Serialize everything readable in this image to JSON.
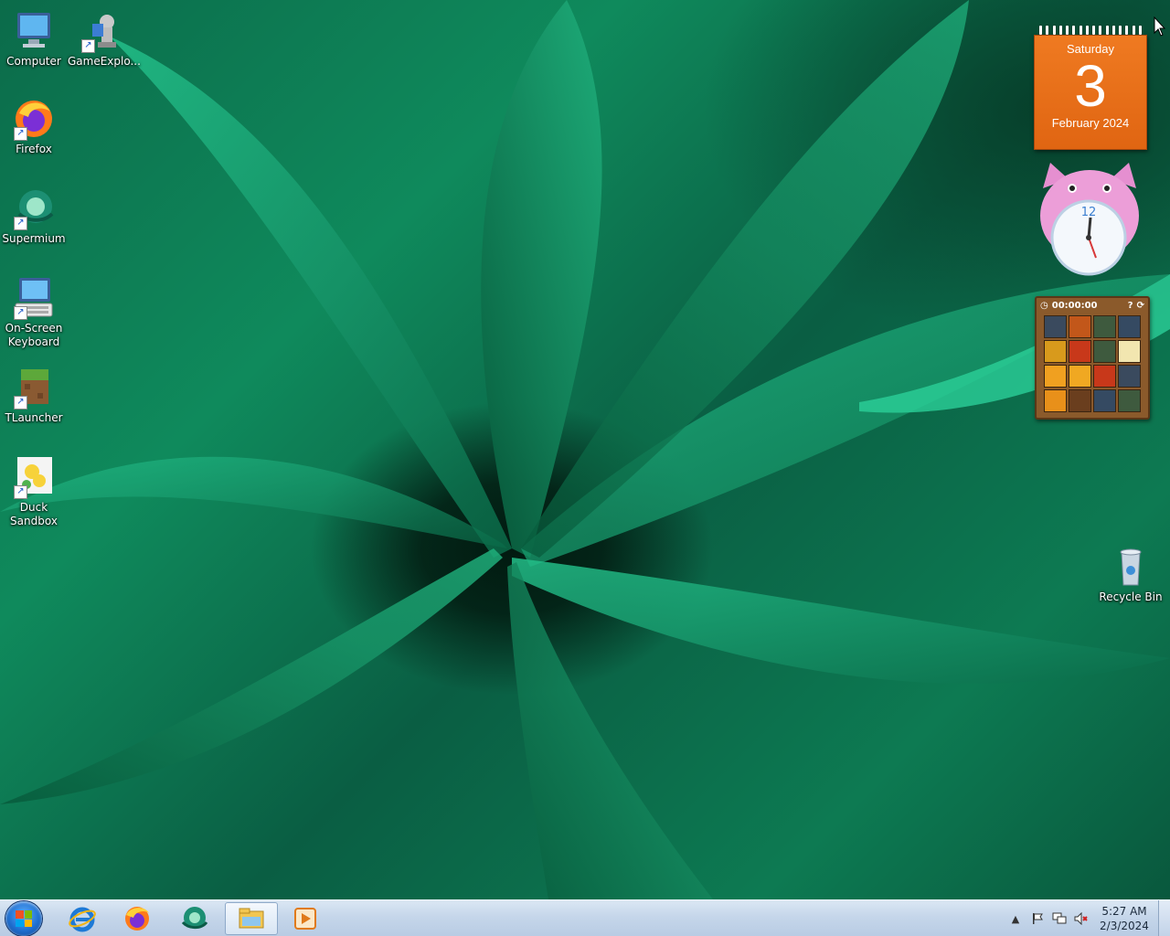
{
  "desktop": {
    "icons": [
      {
        "label": "Computer"
      },
      {
        "label": "GameExplo..."
      },
      {
        "label": "Firefox"
      },
      {
        "label": "Supermium"
      },
      {
        "label": "On-Screen Keyboard"
      },
      {
        "label": "TLauncher"
      },
      {
        "label": "Duck Sandbox"
      },
      {
        "label": "Recycle Bin"
      }
    ]
  },
  "gadgets": {
    "calendar": {
      "weekday": "Saturday",
      "day": "3",
      "month_year": "February 2024"
    },
    "clock": {
      "twelve": "12"
    },
    "puzzle": {
      "timer": "00:00:00"
    }
  },
  "taskbar": {
    "pinned": [
      "start-button",
      "internet-explorer-icon",
      "firefox-icon",
      "supermium-icon",
      "file-explorer-icon",
      "media-player-icon"
    ],
    "clock_time": "5:27 AM",
    "clock_date": "2/3/2024"
  },
  "colors": {
    "calendar_orange": "#e8701a",
    "taskbar": "#c5d6ea",
    "wallpaper_green": "#0f8a5c"
  }
}
